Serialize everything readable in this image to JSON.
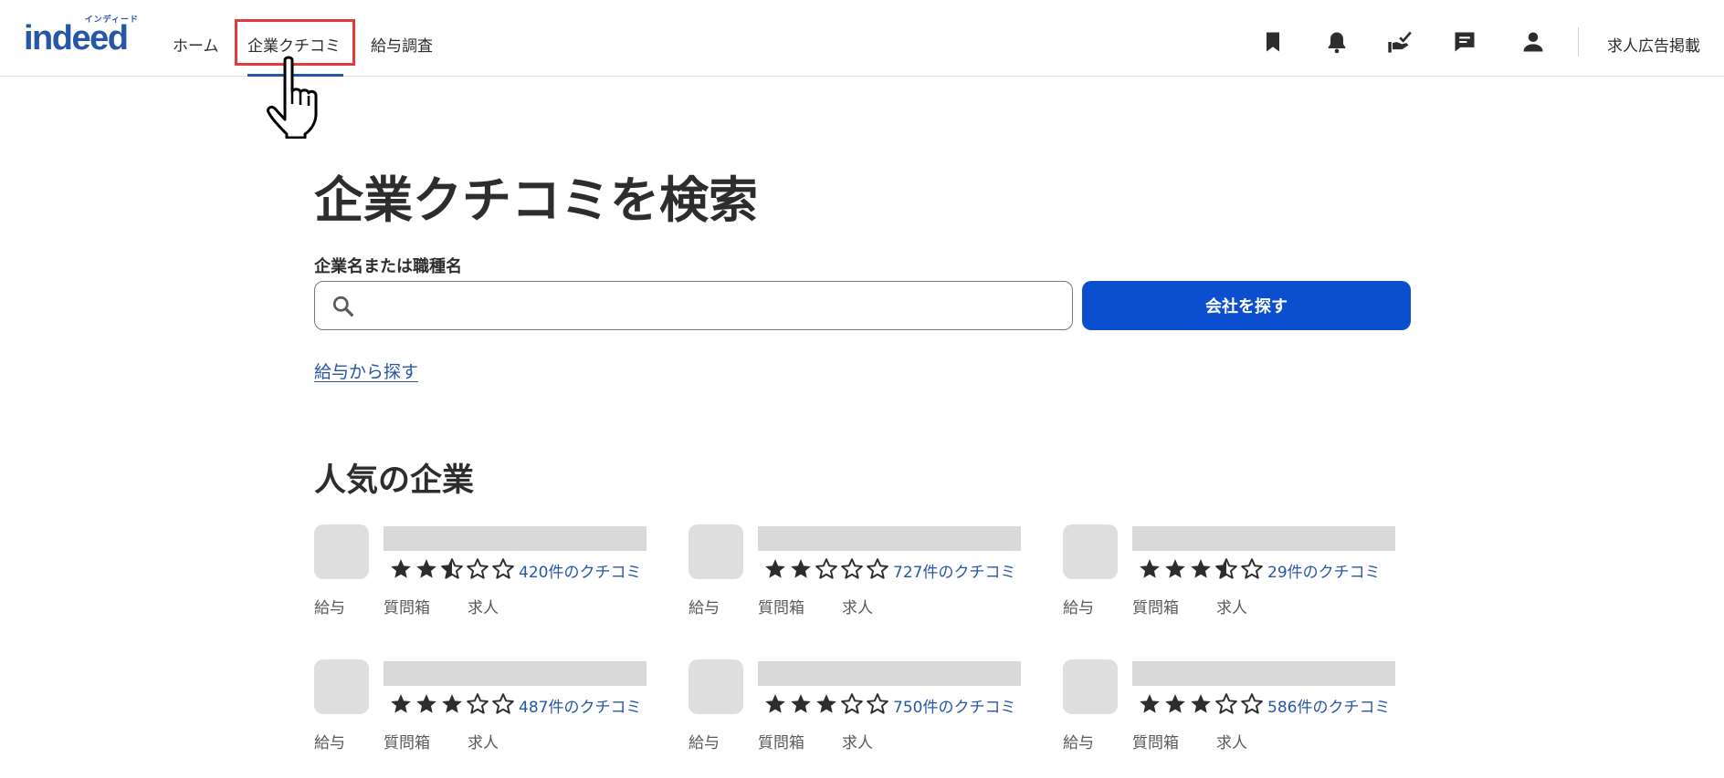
{
  "header": {
    "logo_text": "indeed",
    "logo_kana": "インディード",
    "nav": {
      "home": "ホーム",
      "company_reviews": "企業クチコミ",
      "salary": "給与調査"
    },
    "icons": [
      "bookmark-icon",
      "bell-icon",
      "my-jobs-icon",
      "message-icon",
      "user-icon"
    ],
    "employer_link": "求人広告掲載"
  },
  "main": {
    "title": "企業クチコミを検索",
    "search_label": "企業名または職種名",
    "search_value": "",
    "search_button": "会社を探す",
    "salary_link": "給与から探す",
    "popular_title": "人気の企業"
  },
  "companies": [
    {
      "rating": 2.5,
      "reviews": "420件のクチコミ",
      "links": [
        "給与",
        "質問箱",
        "求人"
      ]
    },
    {
      "rating": 2,
      "reviews": "727件のクチコミ",
      "links": [
        "給与",
        "質問箱",
        "求人"
      ]
    },
    {
      "rating": 3.5,
      "reviews": "29件のクチコミ",
      "links": [
        "給与",
        "質問箱",
        "求人"
      ]
    },
    {
      "rating": 3,
      "reviews": "487件のクチコミ",
      "links": [
        "給与",
        "質問箱",
        "求人"
      ]
    },
    {
      "rating": 3,
      "reviews": "750件のクチコミ",
      "links": [
        "給与",
        "質問箱",
        "求人"
      ]
    },
    {
      "rating": 3,
      "reviews": "586件のクチコミ",
      "links": [
        "給与",
        "質問箱",
        "求人"
      ]
    }
  ],
  "colors": {
    "brand": "#2557a7",
    "button": "#0b4fcf",
    "highlight": "#e33a3a",
    "star": "#2d2d2d"
  }
}
